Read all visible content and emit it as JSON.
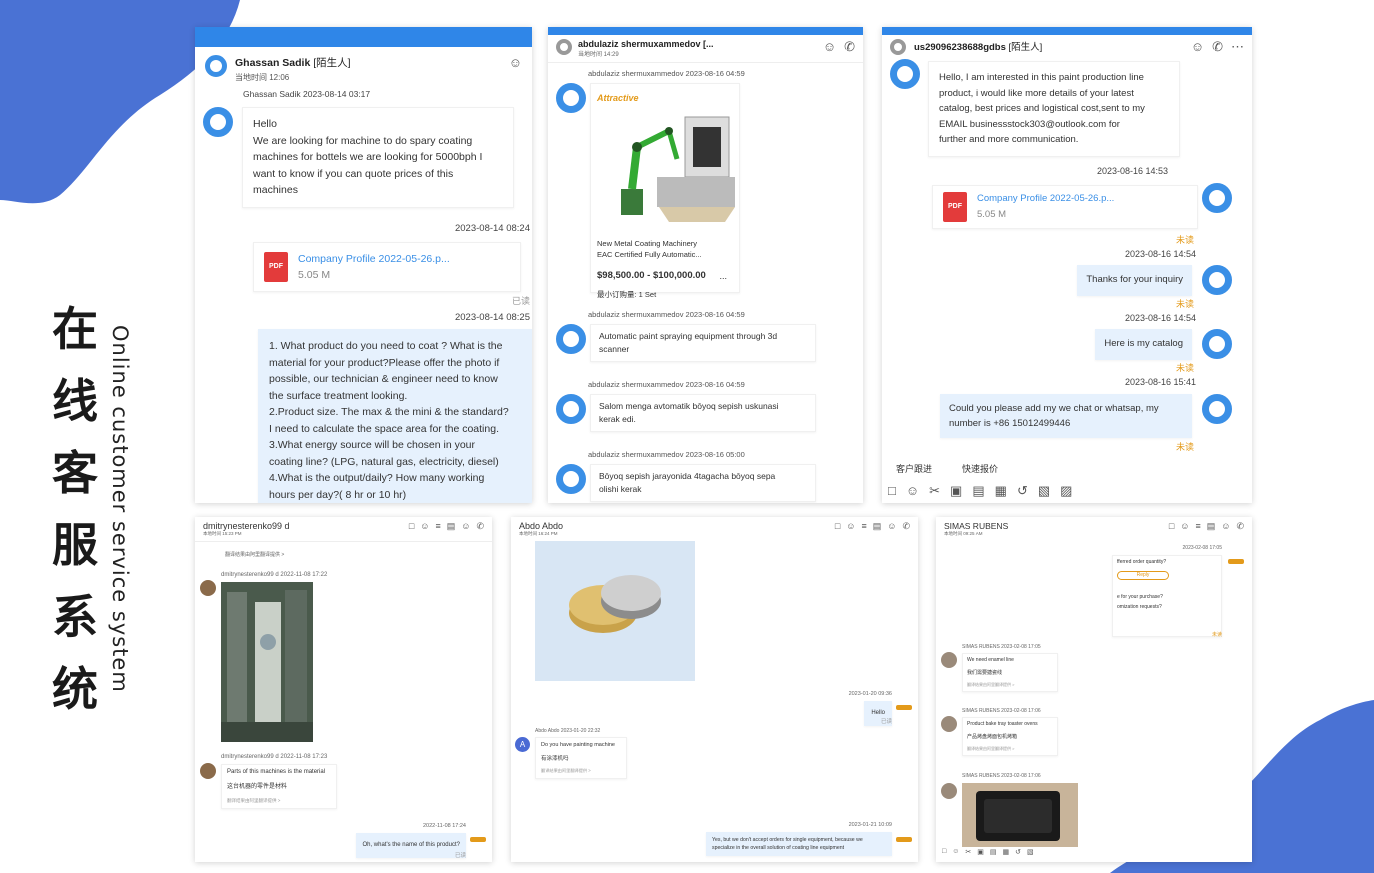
{
  "side": {
    "zh": [
      "在",
      "线",
      "客",
      "服",
      "系",
      "统"
    ],
    "en": "Online customer service system"
  },
  "colors": {
    "accent": "#2f86e8",
    "blob": "#4a72d4",
    "unread": "#e39a1a"
  },
  "panel1": {
    "name": "Ghassan Sadik",
    "tag": "[陌生人]",
    "local_time": "当地时间 12:06",
    "m1_meta": "Ghassan Sadik   2023-08-14 03:17",
    "m1_lines": [
      "Hello",
      "We are looking for machine to do spary coating",
      "machines for bottels we are looking for 5000bph I",
      "want to know if you can quote prices of this",
      "machines"
    ],
    "t1": "2023-08-14 08:24",
    "file_name": "Company Profile 2022-05-26.p...",
    "file_size": "5.05 M",
    "read": "已读",
    "t2": "2023-08-14 08:25",
    "m2_lines": [
      "1. What product do you need to coat ? What is the",
      "material for your product?Please offer the photo if",
      "possible, our technician & engineer need to know",
      "the surface treatment looking.",
      "2.Product size. The max & the mini & the standard?",
      "I need to calculate the space area for the coating.",
      "3.What energy source will be chosen in your",
      "coating line? (LPG, natural gas, electricity, diesel)",
      "4.What is the output/daily? How many working",
      "hours per day?( 8 hr or 10 hr)"
    ]
  },
  "panel2": {
    "name": "abdulaziz shermuxammedov [...",
    "local_time": "当地时间 14:29",
    "m1_meta": "abdulaziz shermuxammedov   2023-08-16 04:59",
    "brand": "Attractive",
    "product_lines": [
      "New Metal Coating Machinery",
      "EAC Certified Fully Automatic..."
    ],
    "price": "$98,500.00 - $100,000.00",
    "moq": "最小订购量: 1 Set",
    "more": "...",
    "m2_meta": "abdulaziz shermuxammedov   2023-08-16 04:59",
    "m2_lines": [
      "Automatic paint spraying equipment through 3d",
      "scanner"
    ],
    "m3_meta": "abdulaziz shermuxammedov   2023-08-16 04:59",
    "m3_lines": [
      "Salom menga avtomatik bōyoq sepish uskunasi",
      "kerak edi."
    ],
    "m4_meta": "abdulaziz shermuxammedov   2023-08-16 05:00",
    "m4_lines": [
      "Bōyoq sepish jarayonida 4tagacha bōyoq sepa",
      "olishi kerak"
    ]
  },
  "panel3": {
    "name": "us29096238688gdbs",
    "tag": "[陌生人]",
    "m1_lines": [
      "Hello, I am interested in this paint production line",
      "product, i would like more details of your latest",
      "catalog, best prices and logistical cost,sent to my",
      "EMAIL businessstock303@outlook.com for",
      "further and more communication."
    ],
    "t1": "2023-08-16 14:53",
    "file_name": "Company Profile 2022-05-26.p...",
    "file_size": "5.05 M",
    "unread": "未读",
    "t2": "2023-08-16 14:54",
    "m2": "Thanks for your inquiry",
    "t3": "2023-08-16 14:54",
    "m3": "Here is my catalog",
    "t4": "2023-08-16 15:41",
    "m4_lines": [
      "Could you please add my we chat or whatsap, my",
      "number is +86 15012499446"
    ],
    "tab1": "客户跟进",
    "tab2": "快速报价"
  },
  "panel4": {
    "name": "dmitrynesterenko99 d",
    "local_time": "本地时间 15:23 PM",
    "translate_hint": "翻译结果由阿里翻译提供 >",
    "m1_meta": "dmitrynesterenko99 d   2022-11-08 17:22",
    "m2_meta": "dmitrynesterenko99 d   2022-11-08 17:23",
    "m2_en": "Parts of this machines is the material",
    "m2_zh": "这台机器的零件是材料",
    "t1": "2022-11-08 17:24",
    "m3": "Oh, what's the name of this product?",
    "read": "已读"
  },
  "panel5": {
    "name": "Abdo Abdo",
    "local_time": "本地时间 16:24 PM",
    "t1": "2023-01-20 09:36",
    "m1": "Hello",
    "read": "已读",
    "m2_meta": "Abdo Abdo   2023-01-20 22:32",
    "m2_en": "Do you have painting machine",
    "m2_zh": "有涂漆机吗",
    "translate_hint": "翻译结果由阿里翻译提供 >",
    "avatar_letter": "A",
    "t2": "2023-01-21 10:09",
    "m3_lines": [
      "Yes, but we don't accept orders for single equipment, because we",
      "specialize in the overall solution of coating line equipment"
    ]
  },
  "panel6": {
    "name": "SIMAS RUBENS",
    "local_time": "本地时间 09:25 AM",
    "t1": "2023-02-08 17:05",
    "q1": "fferred order quantity?",
    "reply": "Reply",
    "q2": "e for your purchase?",
    "q3": "omization requests?",
    "m1_meta": "SIMAS RUBENS   2023-02-08 17:05",
    "m1_en": "We need enamel line",
    "m1_zh": "我们需要搪瓷线",
    "m2_meta": "SIMAS RUBENS   2023-02-08 17:06",
    "m2_en": "Product bake tray toaster ovens",
    "m2_zh": "产品烤盘烤面包机烤箱",
    "m3_meta": "SIMAS RUBENS   2023-02-08 17:06",
    "translate_hint": "翻译结果由阿里翻译提供 >",
    "unread": "未读"
  }
}
